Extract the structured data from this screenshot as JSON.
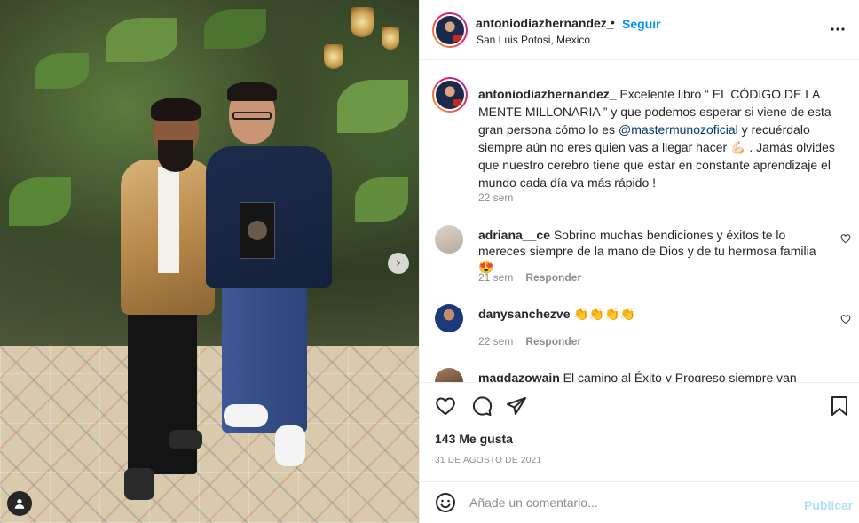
{
  "header": {
    "username": "antoniodiazhernandez_",
    "separator": "•",
    "follow_label": "Seguir",
    "location": "San Luis Potosi, Mexico",
    "more_icon": "more-horizontal-icon"
  },
  "caption": {
    "username": "antoniodiazhernandez_",
    "text_part1": " Excelente libro “ EL CÓDIGO DE LA MENTE MILLONARIA ” y que podemos esperar si viene de esta gran persona cómo lo es ",
    "mention": "@mastermunozoficial",
    "text_part2": " y recuérdalo siempre aún no eres quien vas a llegar hacer 💪🏻 . Jamás olvides que nuestro cerebro tiene que estar en constante aprendizaje el mundo cada día va más rápido !",
    "time": "22 sem"
  },
  "comments": [
    {
      "username": "adriana__ce",
      "text": " Sobrino muchas bendiciones y éxitos te lo mereces siempre de la mano de Dios y de tu hermosa familia 😍",
      "time": "21 sem",
      "reply_label": "Responder"
    },
    {
      "username": "danysanchezve",
      "text": " 👏👏👏👏",
      "time": "22 sem",
      "reply_label": "Responder"
    },
    {
      "username": "magdazowain",
      "text": " El camino al Éxito y Progreso siempre van"
    }
  ],
  "actions": {
    "likes": "143 Me gusta",
    "date": "31 DE AGOSTO DE 2021"
  },
  "add_comment": {
    "placeholder": "Añade un comentario...",
    "publish_label": "Publicar"
  },
  "colors": {
    "accent": "#0095f6",
    "publish_disabled": "#b2dffc",
    "mention": "#00376b",
    "muted": "#8e8e8e"
  }
}
